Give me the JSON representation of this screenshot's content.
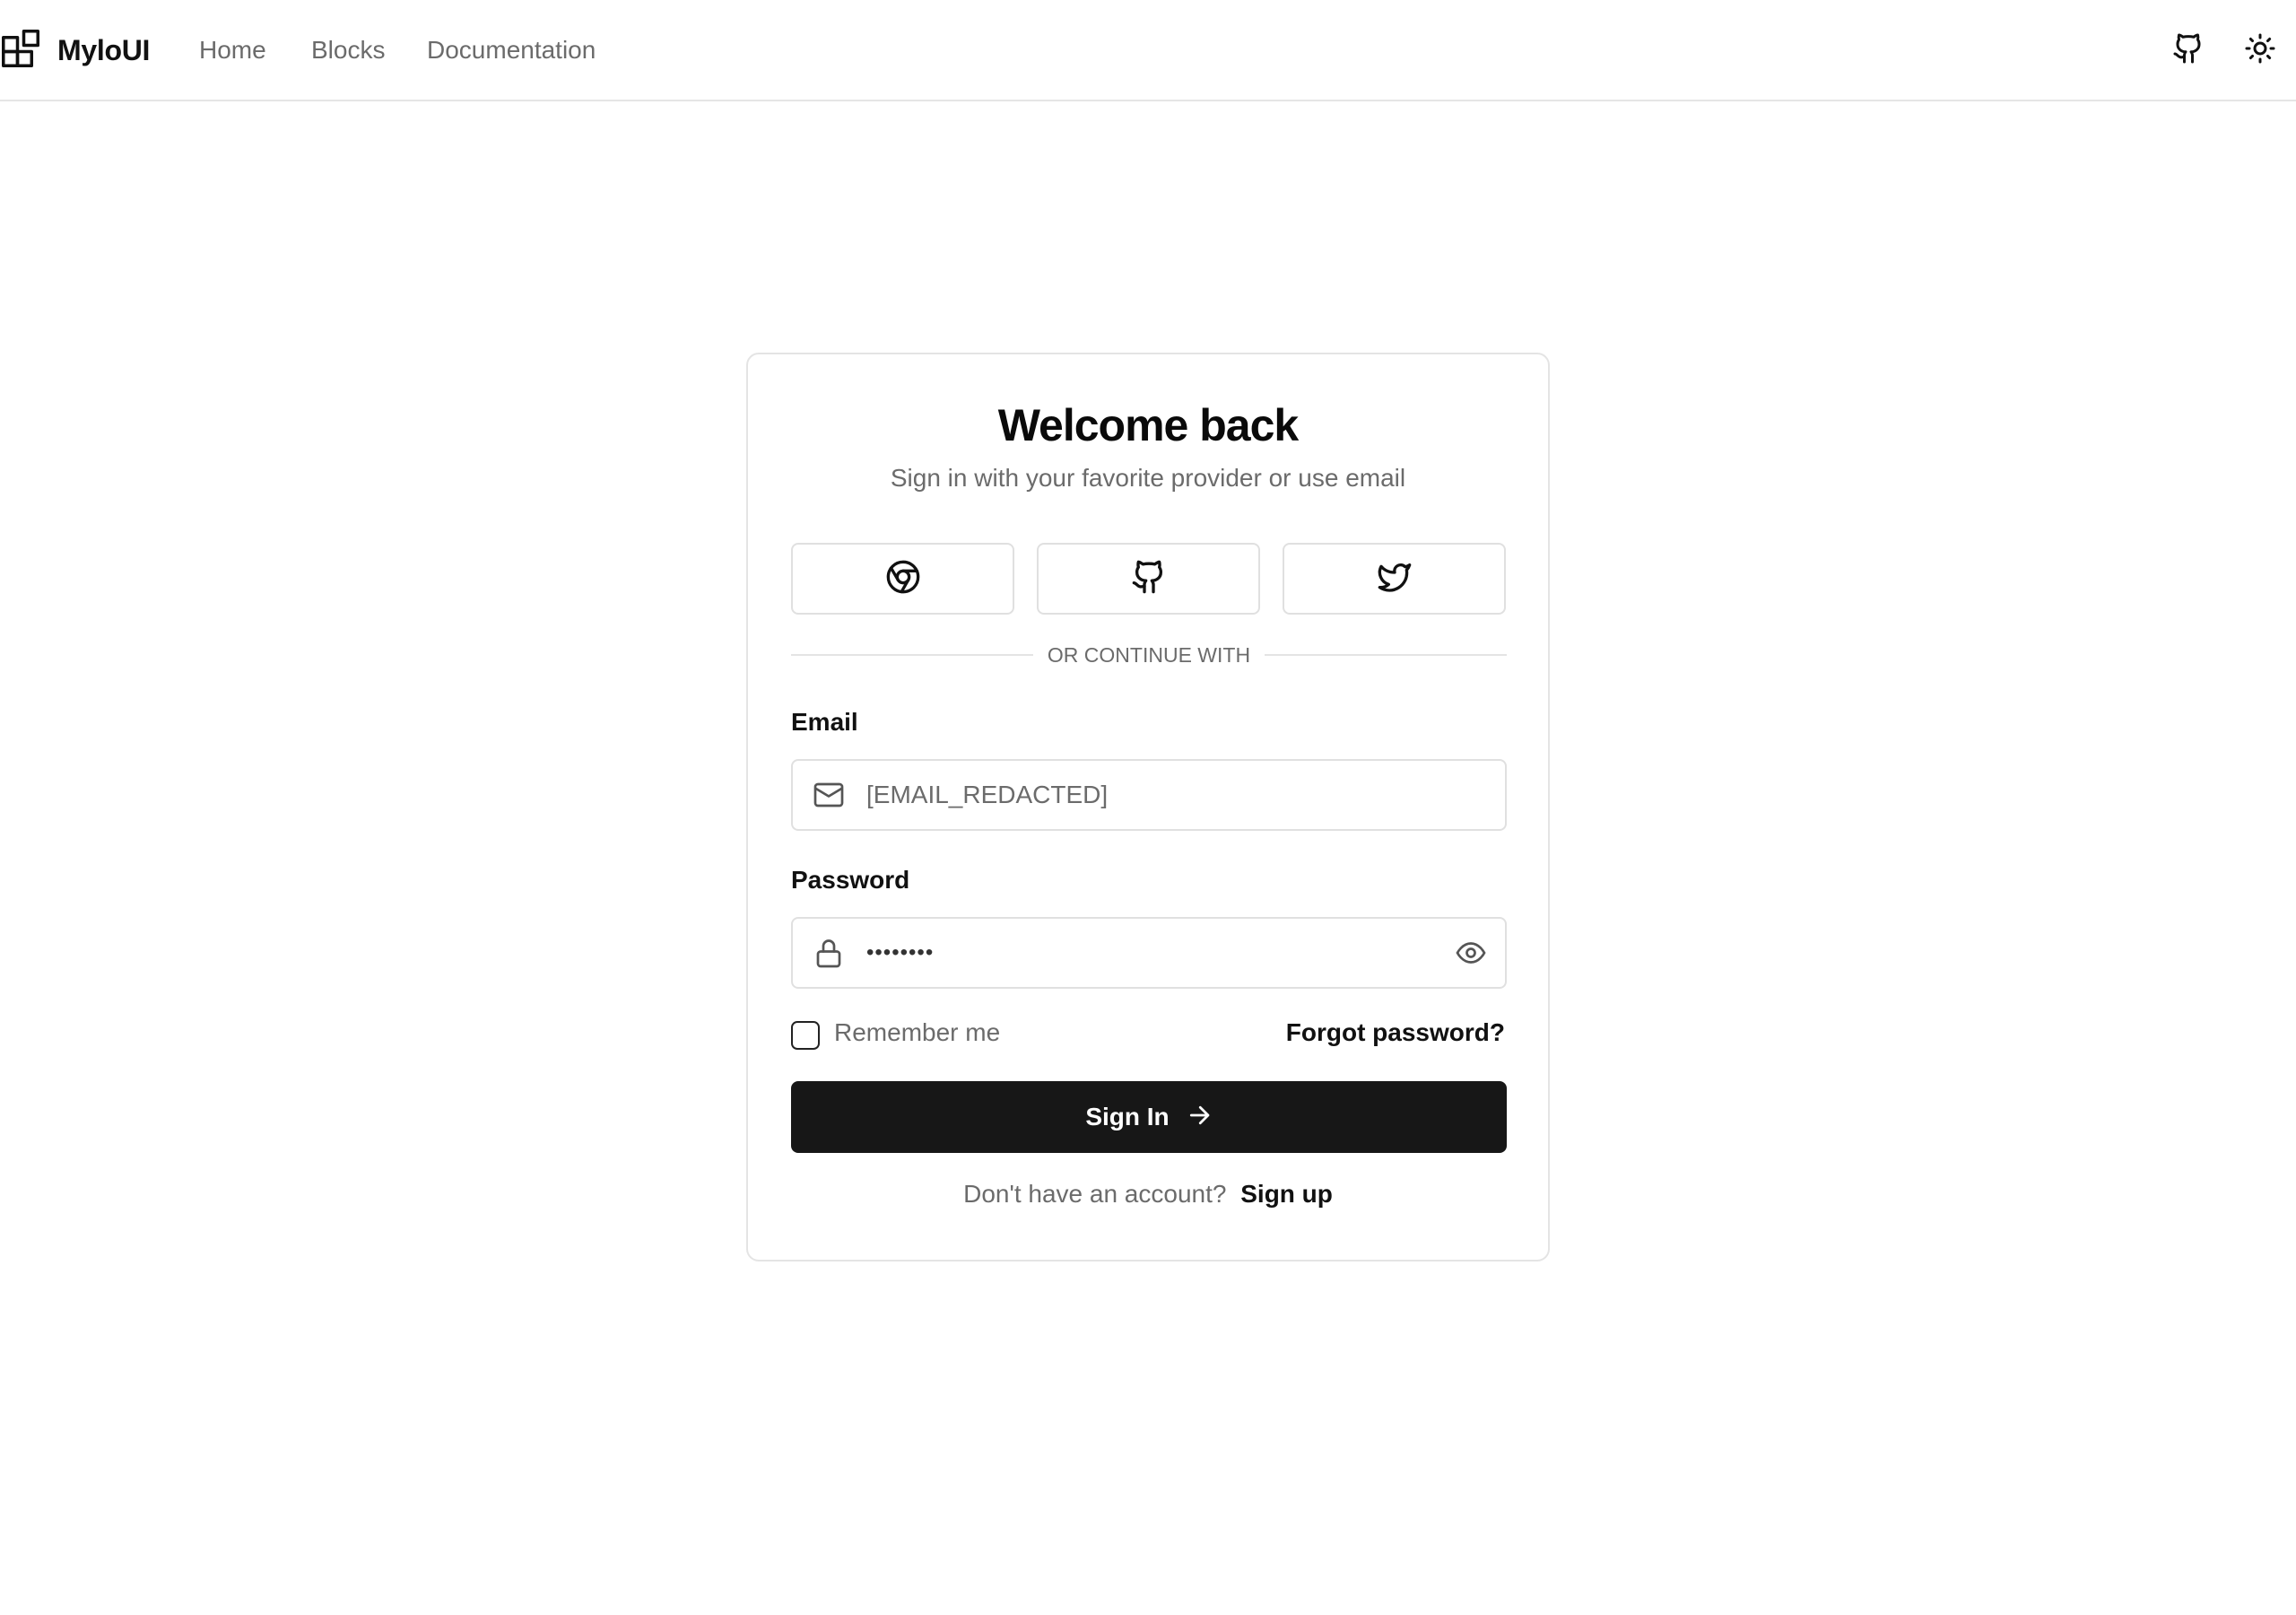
{
  "header": {
    "brand": "MyloUI",
    "nav": [
      "Home",
      "Blocks",
      "Documentation"
    ],
    "icons": {
      "logo": "blocks-icon",
      "github": "github-icon",
      "theme": "sun-icon"
    }
  },
  "login": {
    "title": "Welcome back",
    "subtitle": "Sign in with your favorite provider or use email",
    "providers": [
      "chrome-icon",
      "github-icon",
      "twitter-icon"
    ],
    "divider": "OR CONTINUE WITH",
    "email": {
      "label": "Email",
      "value": "[EMAIL_REDACTED]",
      "icon": "mail-icon"
    },
    "password": {
      "label": "Password",
      "value": "••••••••",
      "icon": "lock-icon",
      "toggle_icon": "eye-icon"
    },
    "remember_label": "Remember me",
    "remember_checked": false,
    "forgot_label": "Forgot password?",
    "submit_label": "Sign In",
    "footer_text": "Don't have an account?",
    "footer_link": "Sign up"
  },
  "colors": {
    "text": "#111111",
    "muted": "#6b6b6b",
    "border": "#e4e4e4",
    "button_bg": "#171717",
    "button_text": "#ffffff"
  }
}
